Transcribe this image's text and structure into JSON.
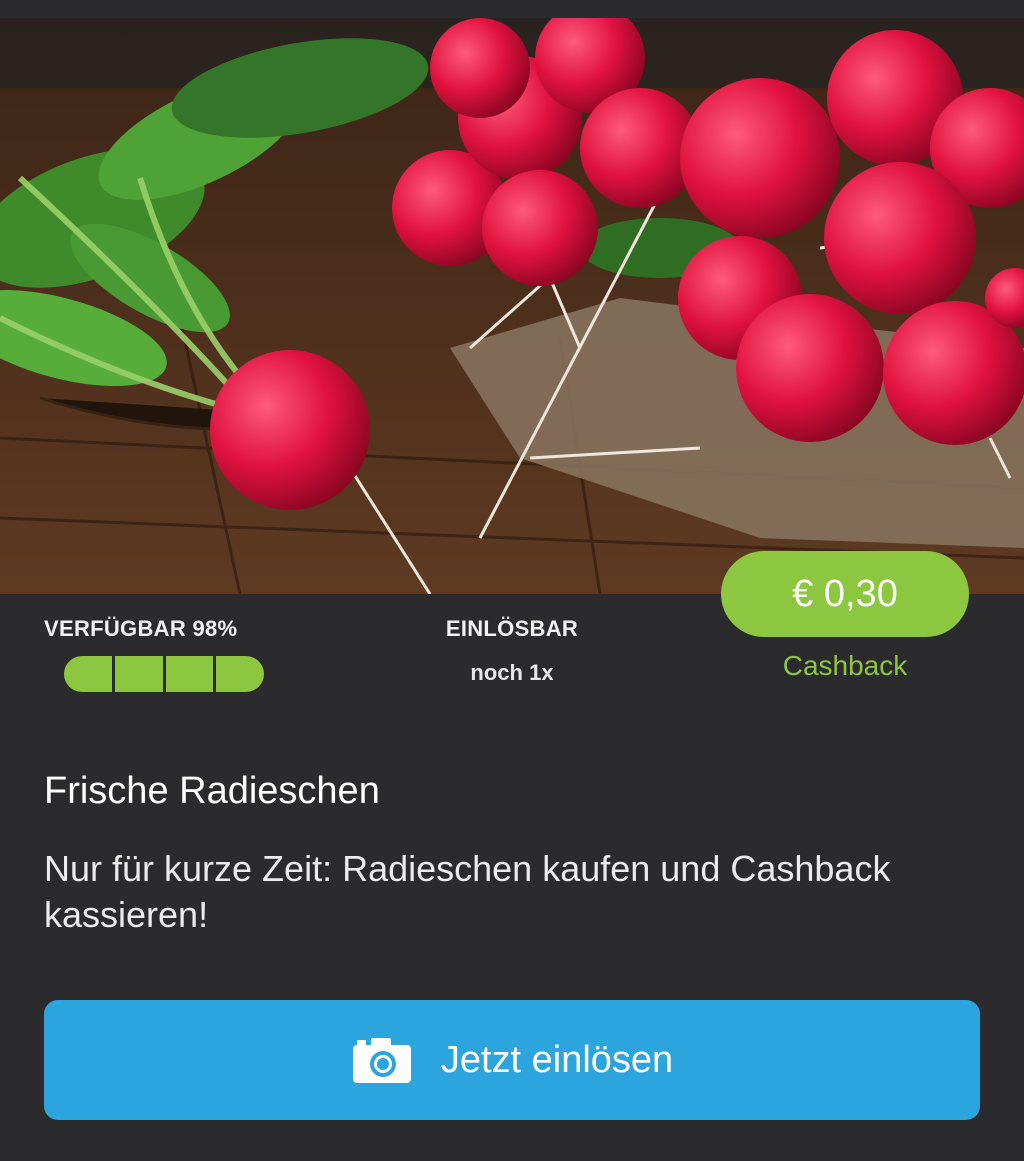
{
  "offer": {
    "available_label": "VERFÜGBAR 98%",
    "available_percent": 98,
    "availability_segments": 4,
    "redeemable_label": "EINLÖSBAR",
    "redeemable_sub": "noch 1x",
    "price": "€ 0,30",
    "cashback_label": "Cashback",
    "title": "Frische Radieschen",
    "description": "Nur für kurze Zeit: Radieschen kaufen und Cashback kassieren!",
    "cta_label": "Jetzt einlösen",
    "cta_icon": "camera-icon"
  },
  "colors": {
    "background": "#2b2b2d",
    "accent_green": "#8dc63f",
    "button_blue": "#2ca4dd"
  }
}
